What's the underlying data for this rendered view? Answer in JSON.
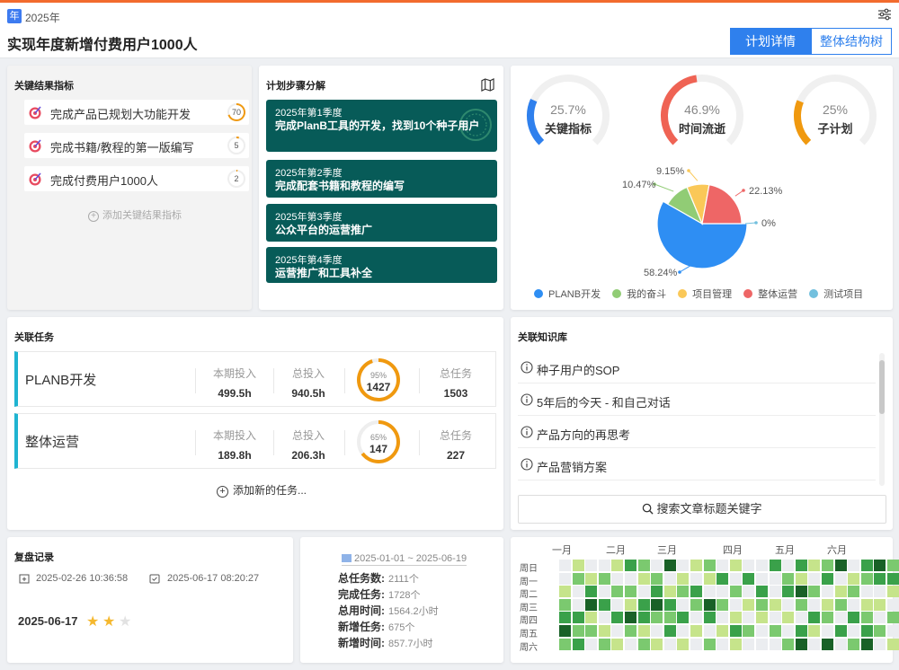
{
  "header": {
    "year_badge": "年",
    "year": "2025年",
    "title": "实现年度新增付费用户1000人",
    "tabs": [
      {
        "label": "计划详情",
        "active": true
      },
      {
        "label": "整体结构树",
        "active": false
      }
    ]
  },
  "key_results": {
    "title": "关键结果指标",
    "items": [
      {
        "label": "完成产品已规划大功能开发",
        "value": "70",
        "progress": 0.7
      },
      {
        "label": "完成书籍/教程的第一版编写",
        "value": "5",
        "progress": 0.05
      },
      {
        "label": "完成付费用户1000人",
        "value": "2",
        "progress": 0.02
      }
    ],
    "add_label": "添加关键结果指标"
  },
  "plan_steps": {
    "title": "计划步骤分解",
    "steps": [
      {
        "quarter": "2025年第1季度",
        "text": "完成PlanB工具的开发，找到10个种子用户"
      },
      {
        "quarter": "2025年第2季度",
        "text": "完成配套书籍和教程的编写"
      },
      {
        "quarter": "2025年第3季度",
        "text": "公众平台的运营推广"
      },
      {
        "quarter": "2025年第4季度",
        "text": "运营推广和工具补全"
      }
    ]
  },
  "gauges": [
    {
      "percent": "25.7%",
      "label": "关键指标",
      "value": 0.257,
      "color": "#2f80ed"
    },
    {
      "percent": "46.9%",
      "label": "时间流逝",
      "value": 0.469,
      "color": "#ef6354"
    },
    {
      "percent": "25%",
      "label": "子计划",
      "value": 0.25,
      "color": "#f0990f"
    }
  ],
  "pie": {
    "slices": [
      {
        "name": "PLANB开发",
        "value": 58.24,
        "label": "58.24%",
        "color": "#2e8ef3"
      },
      {
        "name": "我的奋斗",
        "value": 10.47,
        "label": "10.47%",
        "color": "#91cc75"
      },
      {
        "name": "项目管理",
        "value": 9.15,
        "label": "9.15%",
        "color": "#fac858"
      },
      {
        "name": "整体运营",
        "value": 22.13,
        "label": "22.13%",
        "color": "#ee6666"
      },
      {
        "name": "测试项目",
        "value": 0,
        "label": "0%",
        "color": "#73c0de"
      }
    ]
  },
  "tasks": {
    "title": "关联任务",
    "col_labels": {
      "period": "本期投入",
      "total": "总投入",
      "count": "总任务"
    },
    "rows": [
      {
        "name": "PLANB开发",
        "period": "499.5h",
        "total": "940.5h",
        "percent": "95%",
        "progress": 0.95,
        "done": "1427",
        "count": "1503"
      },
      {
        "name": "整体运营",
        "period": "189.8h",
        "total": "206.3h",
        "percent": "65%",
        "progress": 0.65,
        "done": "147",
        "count": "227"
      }
    ],
    "add_label": "添加新的任务..."
  },
  "knowledge": {
    "title": "关联知识库",
    "items": [
      "种子用户的SOP",
      "5年后的今天 - 和自己对话",
      "产品方向的再思考",
      "产品营销方案"
    ],
    "search_label": "搜索文章标题关键字"
  },
  "review": {
    "title": "复盘记录",
    "created": "2025-02-26 10:36:58",
    "updated": "2025-06-17 08:20:27",
    "date": "2025-06-17",
    "rating": 2,
    "max_rating": 3
  },
  "stats": {
    "range": "2025-01-01 ~ 2025-06-19",
    "rows": [
      {
        "label": "总任务数:",
        "value": "2111个"
      },
      {
        "label": "完成任务:",
        "value": "1728个"
      },
      {
        "label": "总用时间:",
        "value": "1564.2小时"
      },
      {
        "label": "新增任务:",
        "value": "675个"
      },
      {
        "label": "新增时间:",
        "value": "857.7小时"
      }
    ]
  },
  "heatmap": {
    "months": [
      "一月",
      "二月",
      "三月",
      "四月",
      "五月",
      "六月"
    ],
    "days": [
      "周日",
      "周一",
      "周二",
      "周三",
      "周四",
      "周五",
      "周六"
    ],
    "colors": [
      "#ebedf0",
      "#c6e48b",
      "#7bc96f",
      "#3aa14a",
      "#196127"
    ],
    "weeks": [
      [
        0,
        0,
        1,
        2,
        3,
        4,
        2
      ],
      [
        1,
        2,
        0,
        0,
        3,
        2,
        3
      ],
      [
        0,
        1,
        3,
        4,
        1,
        2,
        0
      ],
      [
        0,
        2,
        0,
        3,
        0,
        1,
        2
      ],
      [
        1,
        0,
        2,
        0,
        3,
        0,
        1
      ],
      [
        3,
        0,
        2,
        1,
        4,
        2,
        0
      ],
      [
        2,
        1,
        0,
        3,
        3,
        1,
        2
      ],
      [
        0,
        2,
        3,
        4,
        2,
        0,
        1
      ],
      [
        4,
        0,
        1,
        3,
        2,
        3,
        0
      ],
      [
        0,
        1,
        2,
        0,
        3,
        0,
        1
      ],
      [
        1,
        0,
        3,
        2,
        0,
        1,
        0
      ],
      [
        2,
        1,
        0,
        4,
        3,
        0,
        2
      ],
      [
        0,
        3,
        0,
        2,
        0,
        1,
        0
      ],
      [
        1,
        0,
        2,
        0,
        1,
        3,
        1
      ],
      [
        0,
        3,
        0,
        1,
        0,
        2,
        0
      ],
      [
        0,
        0,
        3,
        2,
        1,
        0,
        0
      ],
      [
        3,
        0,
        0,
        1,
        0,
        2,
        0
      ],
      [
        0,
        2,
        3,
        0,
        1,
        0,
        2
      ],
      [
        3,
        1,
        4,
        2,
        0,
        3,
        4
      ],
      [
        1,
        0,
        2,
        0,
        3,
        1,
        0
      ],
      [
        2,
        3,
        0,
        1,
        2,
        0,
        4
      ],
      [
        4,
        0,
        1,
        2,
        0,
        3,
        0
      ],
      [
        0,
        1,
        2,
        0,
        3,
        0,
        2
      ],
      [
        3,
        2,
        0,
        1,
        2,
        3,
        4
      ],
      [
        4,
        3,
        0,
        1,
        0,
        2,
        0
      ],
      [
        2,
        3,
        1,
        0,
        2,
        0,
        1
      ]
    ]
  }
}
